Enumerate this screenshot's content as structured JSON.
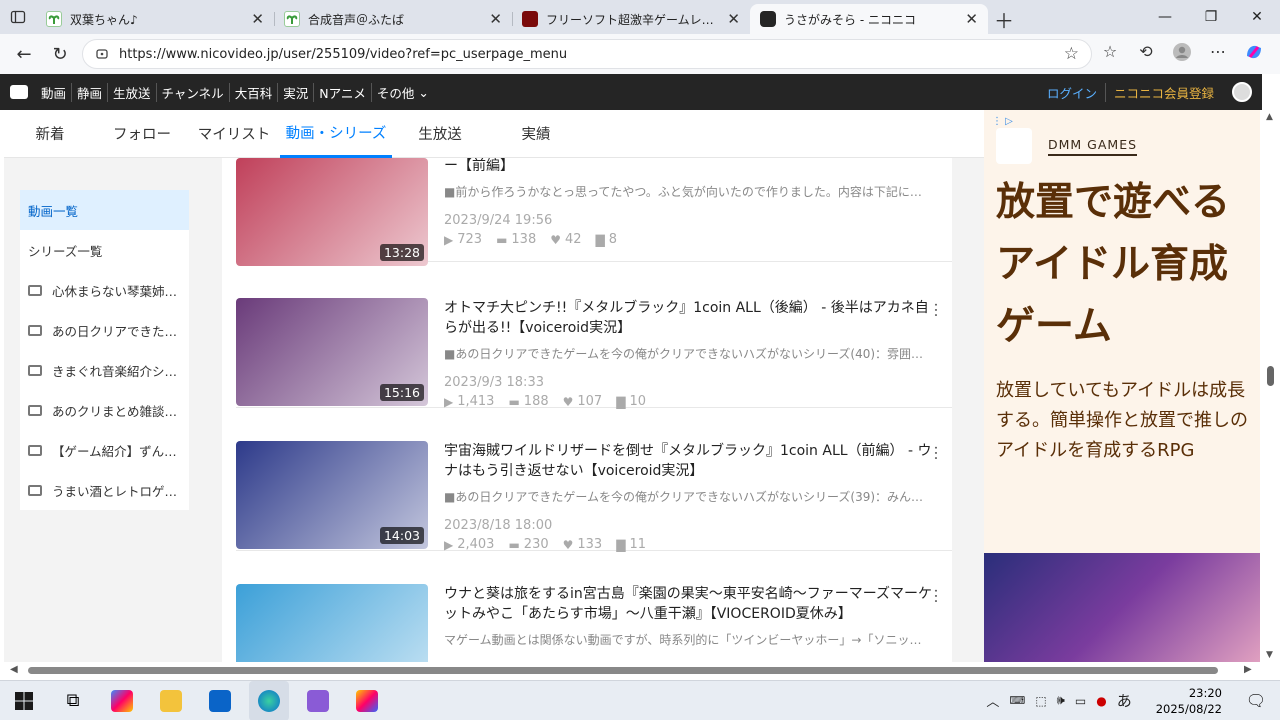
{
  "browser": {
    "tabs": [
      {
        "title": "双葉ちゃん♪",
        "active": false
      },
      {
        "title": "合成音声＠ふたば",
        "active": false
      },
      {
        "title": "フリーソフト超激辛ゲームレビュー",
        "active": false
      },
      {
        "title": "うさがみそら - ニコニコ",
        "active": true
      }
    ],
    "url": "https://www.nicovideo.jp/user/255109/video?ref=pc_userpage_menu"
  },
  "nicobar": {
    "items": [
      "動画",
      "静画",
      "生放送",
      "チャンネル",
      "大百科",
      "実況",
      "Nアニメ",
      "その他"
    ],
    "login": "ログイン",
    "register": "ニコニコ会員登録"
  },
  "subnav": {
    "tabs": [
      "新着",
      "フォロー",
      "マイリスト",
      "動画・シリーズ",
      "生放送",
      "実績"
    ],
    "active_index": 3
  },
  "sidebar": {
    "items": [
      {
        "label": "動画一覧",
        "selected": true,
        "playlist": false
      },
      {
        "label": "シリーズ一覧",
        "selected": false,
        "playlist": false
      },
      {
        "label": "心休まらない琴葉姉妹…",
        "selected": false,
        "playlist": true
      },
      {
        "label": "あの日クリアできたゲ…",
        "selected": false,
        "playlist": true
      },
      {
        "label": "きまぐれ音楽紹介シリ…",
        "selected": false,
        "playlist": true
      },
      {
        "label": "あのクリまとめ雑談…",
        "selected": false,
        "playlist": true
      },
      {
        "label": "【ゲーム紹介】ずんだ…",
        "selected": false,
        "playlist": true
      },
      {
        "label": "うまい酒とレトロゲー…",
        "selected": false,
        "playlist": true
      }
    ]
  },
  "videos": [
    {
      "title": "あかねとつむぎのパチスロこの曲何曲知ってる？どれがお気に入り？のコーナー【前編】",
      "desc": "■前から作ろうかなとっ思ってたやつ。ふと気が向いたので作りました。内容は下記に…",
      "date": "2023/9/24 19:56",
      "duration": "13:28",
      "views": "723",
      "comments": "138",
      "likes": "42",
      "mylists": "8",
      "thumb_color": "#c0405a"
    },
    {
      "title": "オトマチ大ピンチ!!『メタルブラック』1coin ALL（後編） - 後半はアカネ自らが出る!!【voiceroid実況】",
      "desc": "■あの日クリアできたゲームを今の俺がクリアできないハズがないシリーズ(40)：雰囲…",
      "date": "2023/9/3 18:33",
      "duration": "15:16",
      "views": "1,413",
      "comments": "188",
      "likes": "107",
      "mylists": "10",
      "thumb_color": "#6a3b7a"
    },
    {
      "title": "宇宙海賊ワイルドリザードを倒せ『メタルブラック』1coin ALL（前編） - ウナはもう引き返せない【voiceroid実況】",
      "desc": "■あの日クリアできたゲームを今の俺がクリアできないハズがないシリーズ(39)：みん…",
      "date": "2023/8/18 18:00",
      "duration": "14:03",
      "views": "2,403",
      "comments": "230",
      "likes": "133",
      "mylists": "11",
      "thumb_color": "#2d3a8a"
    },
    {
      "title": "ウナと葵は旅をするin宮古島『楽園の果実～東平安名崎～ファーマーズマーケットみやこ「あたらす市場」～八重干瀬』【VIOCEROID夏休み】",
      "desc": "マゲーム動画とは関係ない動画ですが、時系列的に「ツインビーヤッホー」→「ソニッ…",
      "date": "",
      "duration": "",
      "views": "",
      "comments": "",
      "likes": "",
      "mylists": "",
      "thumb_color": "#3ca0d8"
    }
  ],
  "ad": {
    "brand": "DMM GAMES",
    "headline": "放置で遊べるアイドル育成ゲーム",
    "body": "放置していてもアイドルは成長する。簡単操作と放置で推しのアイドルを育成するRPG"
  },
  "taskbar": {
    "time": "23:20",
    "date": "2025/08/22",
    "ime": "あ"
  },
  "colors": {
    "accent": "#0080ff",
    "nicobar_bg": "#252525",
    "register": "#e8b341",
    "ad_text": "#5a2f08"
  }
}
